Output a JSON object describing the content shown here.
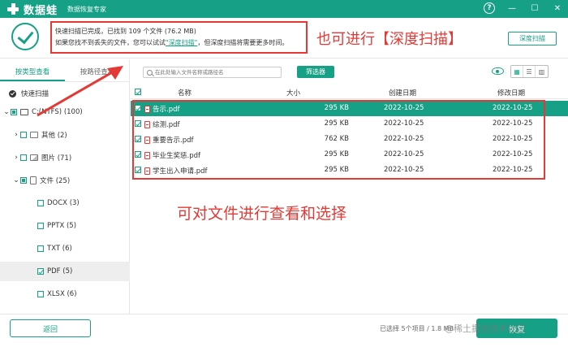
{
  "app": {
    "name": "数据蛙",
    "subtitle": "数据恢复专家"
  },
  "window_controls": {
    "help": "?",
    "minimize": "—",
    "maximize": "☐",
    "close": "✕"
  },
  "header": {
    "message_line1": "快速扫描已完成，已找到 109 个文件 (76.2 MB)",
    "message_line2_prefix": "如果您找不到丢失的文件，您可以试试",
    "message_line2_link": "\"深度扫描\"",
    "message_line2_suffix": "，但深度扫描将需要更多时间。",
    "annotation": "也可进行【深度扫描】",
    "deep_scan_button": "深度扫描"
  },
  "sidebar": {
    "tabs": [
      "按类型查看",
      "按路径查看"
    ],
    "quick_scan": "快速扫描",
    "tree": [
      {
        "label": "C:(NTFS) (100)",
        "level": 0
      },
      {
        "label": "其他 (2)",
        "level": 1
      },
      {
        "label": "图片 (71)",
        "level": 1
      },
      {
        "label": "文件 (25)",
        "level": 1
      },
      {
        "label": "DOCX (3)",
        "level": 2
      },
      {
        "label": "PPTX (5)",
        "level": 2
      },
      {
        "label": "TXT (6)",
        "level": 2
      },
      {
        "label": "PDF (5)",
        "level": 2
      },
      {
        "label": "XLSX (6)",
        "level": 2
      }
    ]
  },
  "toolbar": {
    "search_placeholder": "在此处输入文件名称或路径名",
    "filter_button": "筛选器"
  },
  "table": {
    "columns": [
      "名称",
      "大小",
      "创建日期",
      "修改日期"
    ],
    "rows": [
      {
        "name": "告示.pdf",
        "size": "295 KB",
        "created": "2022-10-25",
        "modified": "2022-10-25"
      },
      {
        "name": "综测.pdf",
        "size": "295 KB",
        "created": "2022-10-25",
        "modified": "2022-10-25"
      },
      {
        "name": "重要告示.pdf",
        "size": "762 KB",
        "created": "2022-10-25",
        "modified": "2022-10-25"
      },
      {
        "name": "毕业生奖惩.pdf",
        "size": "295 KB",
        "created": "2022-10-25",
        "modified": "2022-10-25"
      },
      {
        "name": "学生出入申请.pdf",
        "size": "295 KB",
        "created": "2022-10-25",
        "modified": "2022-10-25"
      }
    ],
    "annotation": "可对文件进行查看和选择"
  },
  "footer": {
    "back_button": "返回",
    "selection_info": "已选择 5个项目 / 1.8 MB",
    "recover_button": "恢复",
    "watermark": "@稀土掘金技术社区"
  },
  "colors": {
    "brand": "#16a085",
    "annotation": "#e53935"
  }
}
